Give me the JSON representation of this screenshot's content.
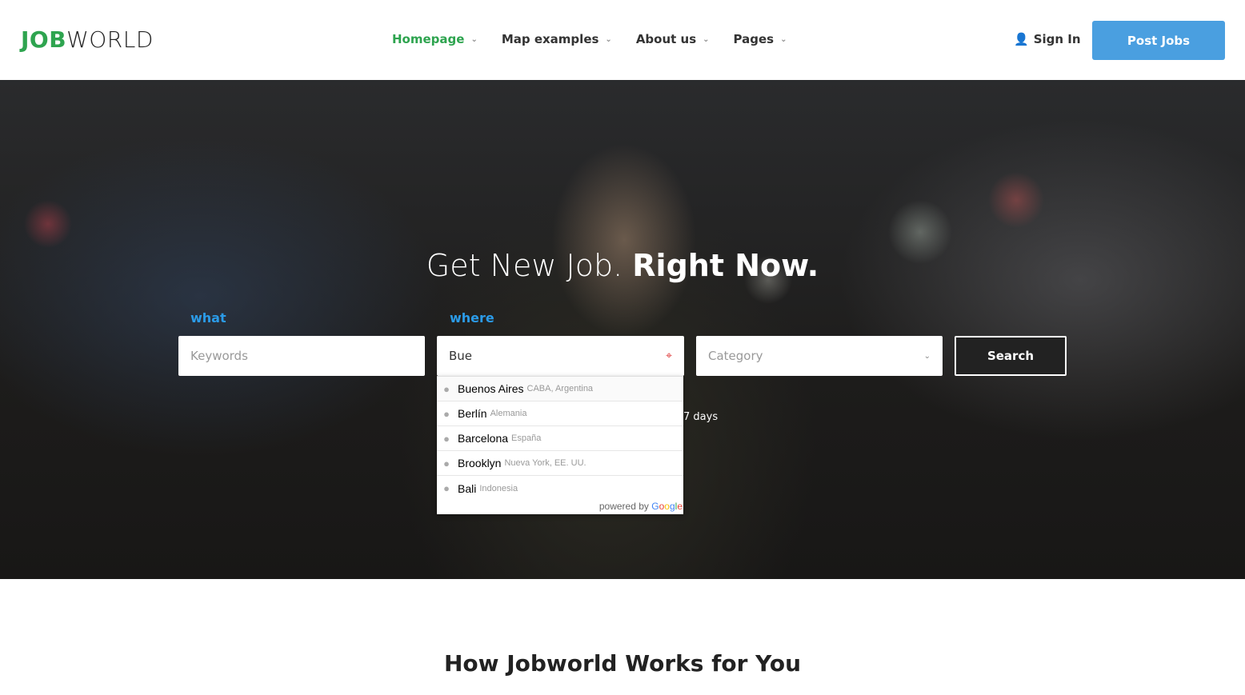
{
  "header": {
    "logo_bold": "JOB",
    "logo_light": "WORLD",
    "nav": [
      {
        "label": "Homepage",
        "active": true
      },
      {
        "label": "Map examples"
      },
      {
        "label": "About us"
      },
      {
        "label": "Pages"
      }
    ],
    "sign_in": "Sign In",
    "post_jobs": "Post Jobs"
  },
  "hero": {
    "headline_light": "Get New Job.",
    "headline_bold": "Right Now.",
    "what_label": "what",
    "where_label": "where",
    "keywords_placeholder": "Keywords",
    "where_value": "Bue",
    "category_placeholder": "Category",
    "search_label": "Search",
    "partial_text": "7 days",
    "autocomplete": [
      {
        "main": "Buenos Aires",
        "secondary": "CABA, Argentina"
      },
      {
        "main": "Berlín",
        "secondary": "Alemania"
      },
      {
        "main": "Barcelona",
        "secondary": "España"
      },
      {
        "main": "Brooklyn",
        "secondary": "Nueva York, EE. UU."
      },
      {
        "main": "Bali",
        "secondary": "Indonesia"
      }
    ],
    "powered_by": "powered by",
    "google": "Google"
  },
  "section": {
    "title": "How Jobworld Works for You"
  },
  "colors": {
    "brand_green": "#2ea44f",
    "accent_blue": "#4a9fe0",
    "label_blue": "#2b9be8"
  }
}
